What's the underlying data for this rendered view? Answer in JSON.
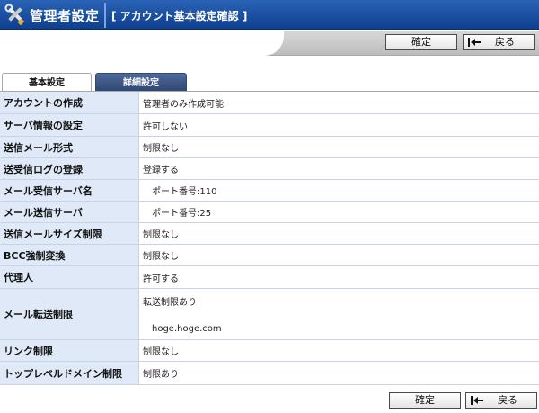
{
  "header": {
    "title": "管理者設定",
    "subtitle": "[ アカウント基本設定確認 ]"
  },
  "toolbar": {
    "confirm_label": "確定",
    "back_label": "戻る"
  },
  "tabs": [
    {
      "label": "基本設定",
      "active": true
    },
    {
      "label": "詳細設定",
      "active": false
    }
  ],
  "settings": [
    {
      "key": "アカウントの作成",
      "value": "管理者のみ作成可能"
    },
    {
      "key": "サーバ情報の設定",
      "value": "許可しない"
    },
    {
      "key": "送信メール形式",
      "value": "制限なし"
    },
    {
      "key": "送受信ログの登録",
      "value": "登録する"
    },
    {
      "key": "メール受信サーバ名",
      "value": "ポート番号:110"
    },
    {
      "key": "メール送信サーバ",
      "value": "ポート番号:25"
    },
    {
      "key": "送信メールサイズ制限",
      "value": "制限なし"
    },
    {
      "key": "BCC強制変換",
      "value": "制限なし"
    },
    {
      "key": "代理人",
      "value": "許可する"
    },
    {
      "key": "メール転送制限",
      "value": "転送制限あり",
      "value2": "hoge.hoge.com"
    },
    {
      "key": "リンク制限",
      "value": "制限なし"
    },
    {
      "key": "トップレベルドメイン制限",
      "value": "制限あり"
    }
  ],
  "colors": {
    "header_blue": "#1a4ea3",
    "key_bg": "#dfe9f7",
    "tab_active_bg": "#3b5586"
  }
}
